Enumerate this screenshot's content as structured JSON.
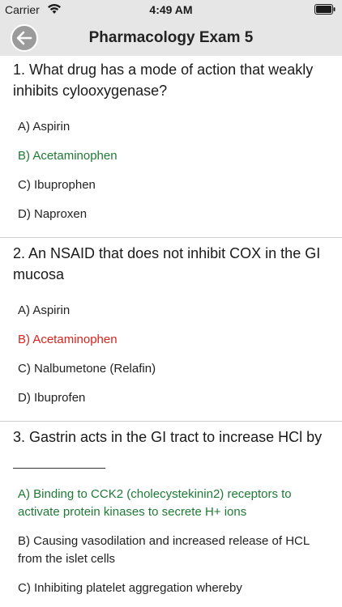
{
  "status_bar": {
    "carrier": "Carrier",
    "time": "4:49 AM"
  },
  "nav": {
    "title": "Pharmacology Exam 5",
    "back_icon": "back-arrow-icon"
  },
  "colors": {
    "correct": "#1f7a36",
    "wrong": "#d9231c",
    "header_bg": "#e6e6e6"
  },
  "questions": [
    {
      "text": "1. What drug has a mode of action that weakly inhibits cylooxygenase?",
      "options": [
        {
          "label": "A) Aspirin",
          "state": "normal"
        },
        {
          "label": "B) Acetaminophen",
          "state": "correct"
        },
        {
          "label": "C) Ibuprophen",
          "state": "normal"
        },
        {
          "label": "D) Naproxen",
          "state": "normal"
        }
      ]
    },
    {
      "text": "2. An NSAID that does not inhibit COX in the GI mucosa",
      "options": [
        {
          "label": "A) Aspirin",
          "state": "normal"
        },
        {
          "label": "B) Acetaminophen",
          "state": "wrong"
        },
        {
          "label": "C) Nalbumetone (Relafin)",
          "state": "normal"
        },
        {
          "label": "D) Ibuprofen",
          "state": "normal"
        }
      ]
    },
    {
      "text": "3. Gastrin acts in the GI tract to increase HCl by",
      "options": [
        {
          "label": "A) Binding to CCK2 (cholecystekinin2) receptors to activate protein kinases to secrete H+ ions",
          "state": "correct"
        },
        {
          "label": "B) Causing vasodilation and increased release of HCL from the islet cells",
          "state": "normal"
        },
        {
          "label": "C) Inhibiting platelet aggregation whereby",
          "state": "normal"
        }
      ]
    }
  ]
}
